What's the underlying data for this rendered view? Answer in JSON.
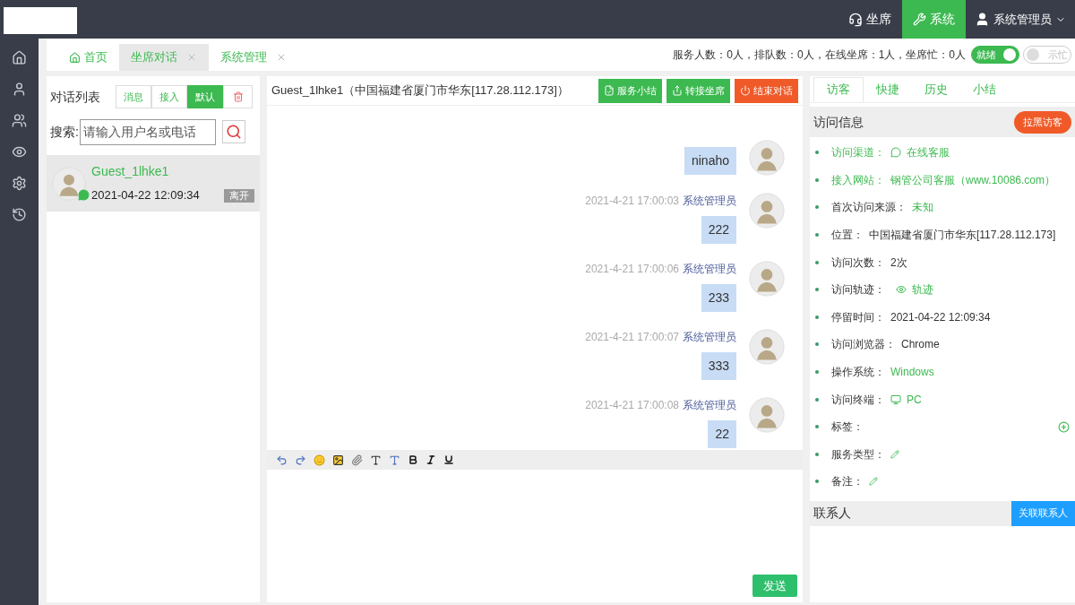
{
  "top_nav": [
    {
      "label": "坐席",
      "selected": false
    },
    {
      "label": "系统",
      "selected": true
    }
  ],
  "user": {
    "name": "系统管理员"
  },
  "tabs": [
    {
      "label": "首页",
      "selected": false,
      "closable": false,
      "kind": "home"
    },
    {
      "label": "坐席对话",
      "selected": true,
      "closable": true,
      "kind": "page"
    },
    {
      "label": "系统管理",
      "selected": false,
      "closable": true,
      "kind": "page"
    }
  ],
  "stats": "服务人数：0人，排队数：0人，在线坐席：1人，坐席忙：0人",
  "status_switches": [
    {
      "label": "就绪",
      "on": true
    },
    {
      "label": "示忙",
      "on": false
    }
  ],
  "conversation_list": {
    "title": "对话列表",
    "filters": [
      {
        "label": "消息",
        "selected": false
      },
      {
        "label": "接入",
        "selected": false
      },
      {
        "label": "默认",
        "selected": true
      }
    ],
    "search_label": "搜索:",
    "placeholder": "请输入用户名或电话",
    "items": [
      {
        "name": "Guest_1lhke1",
        "time": "2021-04-22 12:09:34",
        "status": "离开",
        "selected": true
      }
    ]
  },
  "chat": {
    "title": "Guest_1lhke1（中国福建省厦门市华东[117.28.112.173]）",
    "actions": [
      {
        "label": "服务小结",
        "kind": "summary"
      },
      {
        "label": "转接坐席",
        "kind": "transfer"
      },
      {
        "label": "结束对话",
        "kind": "end"
      }
    ],
    "messages": [
      {
        "text": "ninaho"
      },
      {
        "time": "2021-4-21 17:00:03",
        "sender": "系统管理员",
        "text": "222"
      },
      {
        "time": "2021-4-21 17:00:06",
        "sender": "系统管理员",
        "text": "233"
      },
      {
        "time": "2021-4-21 17:00:07",
        "sender": "系统管理员",
        "text": "333"
      },
      {
        "time": "2021-4-21 17:00:08",
        "sender": "系统管理员",
        "text": "22"
      }
    ],
    "send": "发送"
  },
  "visitor_panel": {
    "tabs": [
      {
        "label": "访客",
        "selected": true
      },
      {
        "label": "快捷",
        "selected": false
      },
      {
        "label": "历史",
        "selected": false
      },
      {
        "label": "小结",
        "selected": false
      }
    ],
    "section_title": "访问信息",
    "blacklist_button": "拉黑访客",
    "rows": [
      {
        "label": "访问渠道：",
        "value": "在线客服",
        "kind": "channel"
      },
      {
        "label": "接入网站：",
        "value": "钢管公司客服（www.10086.com）",
        "kind": "site"
      },
      {
        "label": "首次访问来源：",
        "value": "未知",
        "kind": "green"
      },
      {
        "label": "位置：",
        "value": "中国福建省厦门市华东[117.28.112.173]",
        "kind": "plain"
      },
      {
        "label": "访问次数：",
        "value": "2次",
        "kind": "plain"
      },
      {
        "label": "访问轨迹：",
        "value": "轨迹",
        "kind": "trail"
      },
      {
        "label": "停留时间：",
        "value": "2021-04-22 12:09:34",
        "kind": "plain"
      },
      {
        "label": "访问浏览器：",
        "value": "Chrome",
        "kind": "plain"
      },
      {
        "label": "操作系统：",
        "value": "Windows",
        "kind": "green"
      },
      {
        "label": "访问终端：",
        "value": "PC",
        "kind": "device"
      },
      {
        "label": "标签：",
        "kind": "tag"
      },
      {
        "label": "服务类型：",
        "kind": "edit"
      },
      {
        "label": "备注：",
        "kind": "edit"
      }
    ],
    "contact_title": "联系人",
    "contact_button": "关联联系人"
  }
}
